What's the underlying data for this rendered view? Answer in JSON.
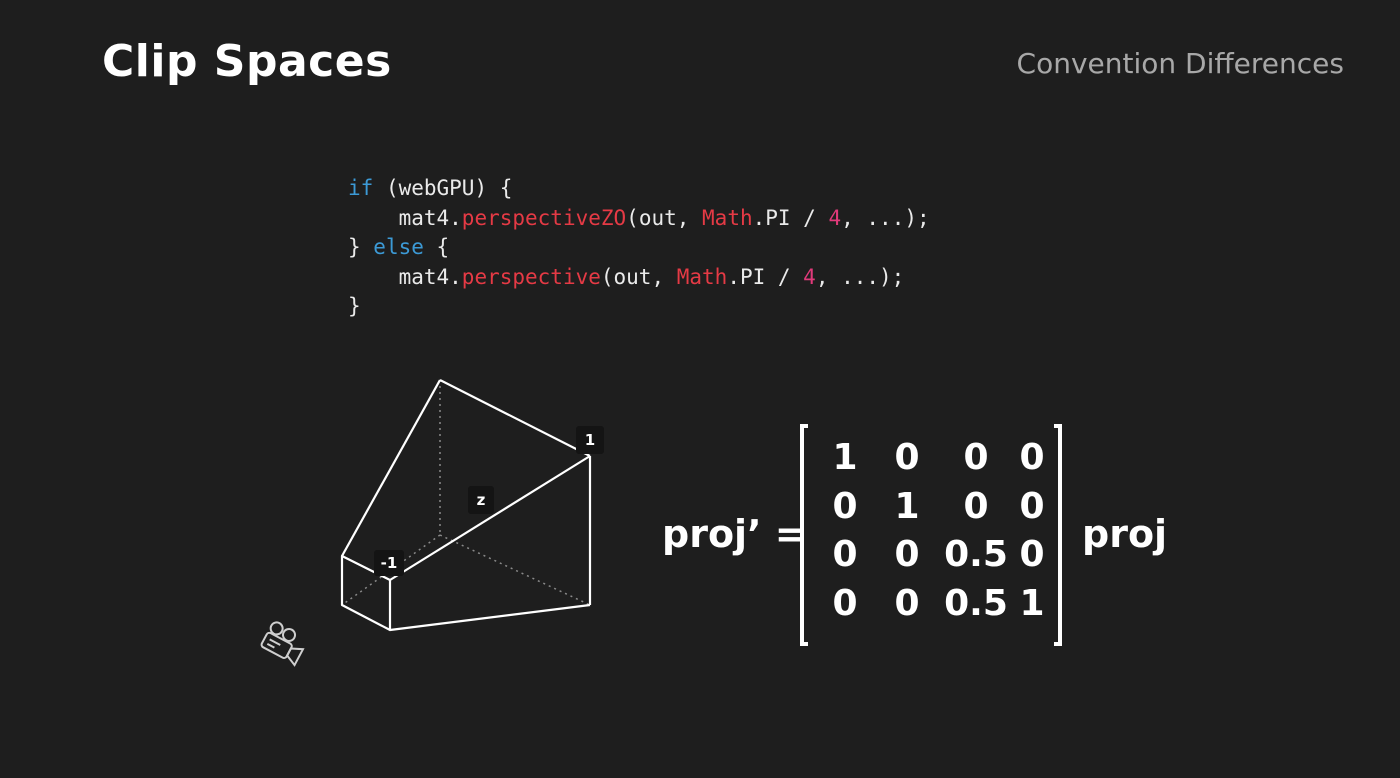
{
  "title": "Clip Spaces",
  "subtitle": "Convention Differences",
  "code": {
    "lines": [
      [
        {
          "t": "if",
          "c": "kw"
        },
        {
          "t": " (webGPU) {",
          "c": ""
        }
      ],
      [
        {
          "t": "    mat4.",
          "c": ""
        },
        {
          "t": "perspectiveZO",
          "c": "fn"
        },
        {
          "t": "(out, ",
          "c": ""
        },
        {
          "t": "Math",
          "c": "cls"
        },
        {
          "t": ".PI / ",
          "c": ""
        },
        {
          "t": "4",
          "c": "num"
        },
        {
          "t": ", ...);",
          "c": ""
        }
      ],
      [
        {
          "t": "} ",
          "c": ""
        },
        {
          "t": "else",
          "c": "kw"
        },
        {
          "t": " {",
          "c": ""
        }
      ],
      [
        {
          "t": "    mat4.",
          "c": ""
        },
        {
          "t": "perspective",
          "c": "fn"
        },
        {
          "t": "(out, ",
          "c": ""
        },
        {
          "t": "Math",
          "c": "cls"
        },
        {
          "t": ".PI / ",
          "c": ""
        },
        {
          "t": "4",
          "c": "num"
        },
        {
          "t": ", ...);",
          "c": ""
        }
      ],
      [
        {
          "t": "}",
          "c": ""
        }
      ]
    ]
  },
  "diagram": {
    "labels": {
      "far": "1",
      "axis": "z",
      "near": "-1"
    },
    "icon": "video-camera-icon"
  },
  "equation": {
    "lhs": "proj’ =",
    "rhs": "proj",
    "matrix": [
      [
        "1",
        "0",
        "0",
        "0"
      ],
      [
        "0",
        "1",
        "0",
        "0"
      ],
      [
        "0",
        "0",
        "0.5",
        "0"
      ],
      [
        "0",
        "0",
        "0.5",
        "1"
      ]
    ]
  },
  "colors": {
    "background": "#1e1e1e",
    "keyword": "#3c9ad6",
    "function": "#e53a45",
    "number": "#e03a7a",
    "subtitle": "#a8a8a8"
  }
}
